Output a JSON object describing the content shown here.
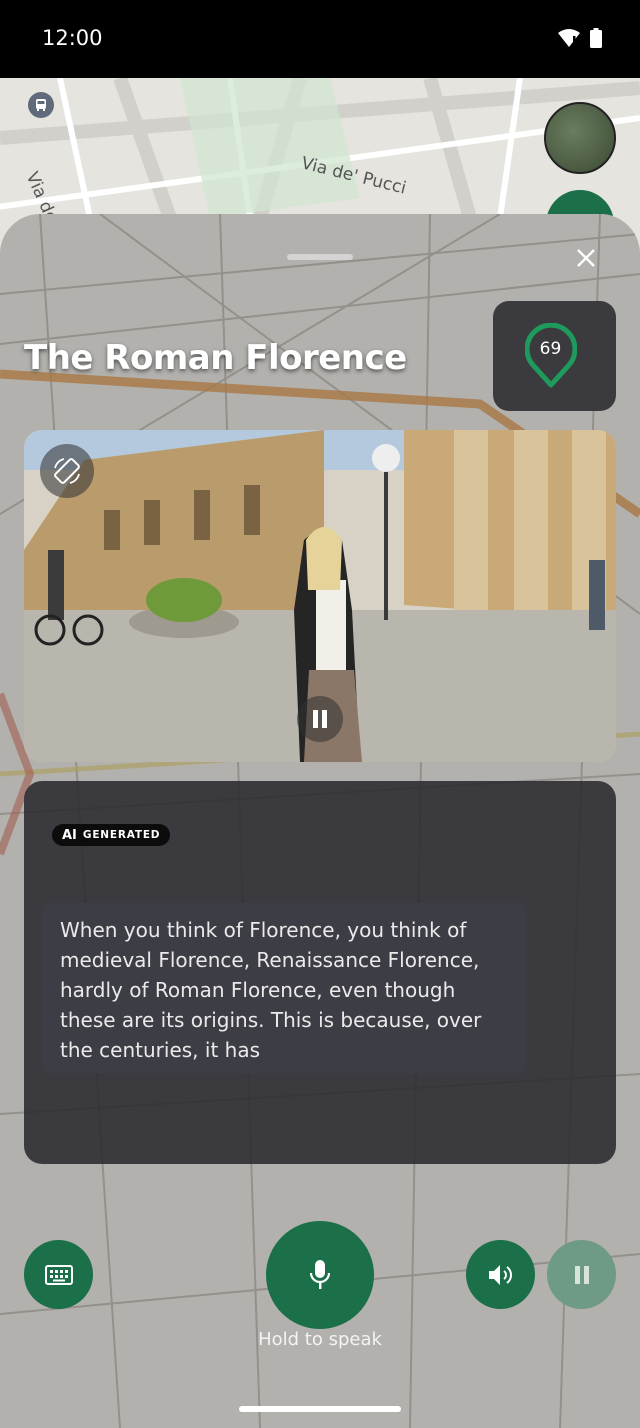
{
  "status_bar": {
    "time": "12:00",
    "icons": [
      "wifi-icon",
      "battery-icon"
    ]
  },
  "map": {
    "streets": [
      "Via de' Pucci",
      "Via dei G"
    ]
  },
  "sheet": {
    "title": "The Roman Florence",
    "score": "69",
    "ai_badge": {
      "prefix": "AI",
      "label": "GENERATED"
    },
    "transcript": "When you think of Florence, you think of medieval Florence, Renaissance Florence, hardly of Roman Florence, even though these are its origins. This is because, over the centuries, it has",
    "hold_to_speak": "Hold to speak",
    "icons": {
      "close": "close-icon",
      "score": "location-pin-icon",
      "rotate": "screen-rotation-icon",
      "video_pause": "pause-icon",
      "keyboard": "keyboard-icon",
      "mic": "microphone-icon",
      "speaker": "volume-icon",
      "pause": "pause-icon"
    }
  },
  "colors": {
    "accent": "#1b6f49",
    "accent_muted": "#6f9a85",
    "panel": "#2a2a30",
    "score_ring": "#1e9a5c"
  }
}
